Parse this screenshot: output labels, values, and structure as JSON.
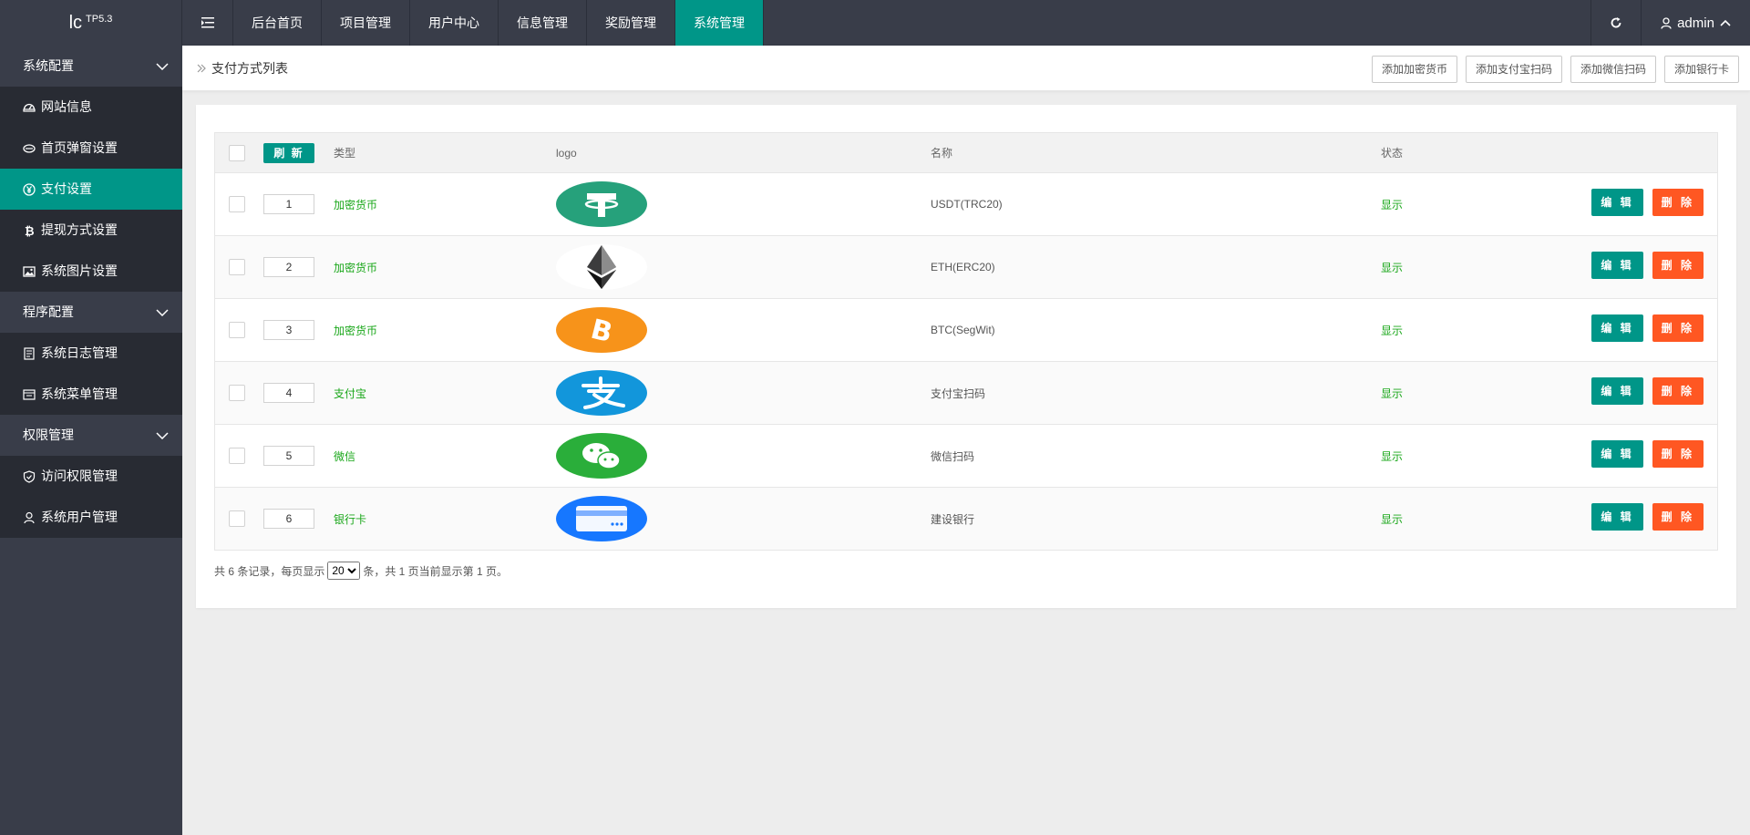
{
  "brand": {
    "name": "lc",
    "version": "TP5.3"
  },
  "topnav": [
    "后台首页",
    "项目管理",
    "用户中心",
    "信息管理",
    "奖励管理",
    "系统管理"
  ],
  "topnav_active": 5,
  "user": {
    "name": "admin"
  },
  "sidebar": {
    "groups": [
      {
        "label": "系统配置",
        "items": [
          {
            "label": "网站信息",
            "icon": "dashboard-icon"
          },
          {
            "label": "首页弹窗设置",
            "icon": "popup-icon"
          },
          {
            "label": "支付设置",
            "icon": "yen-icon",
            "active": true
          },
          {
            "label": "提现方式设置",
            "icon": "bitcoin-icon"
          },
          {
            "label": "系统图片设置",
            "icon": "image-icon"
          }
        ]
      },
      {
        "label": "程序配置",
        "items": [
          {
            "label": "系统日志管理",
            "icon": "log-icon"
          },
          {
            "label": "系统菜单管理",
            "icon": "menu-icon"
          }
        ]
      },
      {
        "label": "权限管理",
        "items": [
          {
            "label": "访问权限管理",
            "icon": "shield-icon"
          },
          {
            "label": "系统用户管理",
            "icon": "user-icon"
          }
        ]
      }
    ]
  },
  "page": {
    "breadcrumb": "支付方式列表",
    "buttons": [
      "添加加密货币",
      "添加支付宝扫码",
      "添加微信扫码",
      "添加银行卡"
    ]
  },
  "table": {
    "refresh_label": "刷 新",
    "headers": {
      "type": "类型",
      "logo": "logo",
      "name": "名称",
      "state": "状态"
    },
    "rows": [
      {
        "sort": "1",
        "type": "加密货币",
        "name": "USDT(TRC20)",
        "state": "显示",
        "logo": "tether-logo"
      },
      {
        "sort": "2",
        "type": "加密货币",
        "name": "ETH(ERC20)",
        "state": "显示",
        "logo": "ethereum-logo"
      },
      {
        "sort": "3",
        "type": "加密货币",
        "name": "BTC(SegWit)",
        "state": "显示",
        "logo": "bitcoin-logo"
      },
      {
        "sort": "4",
        "type": "支付宝",
        "name": "支付宝扫码",
        "state": "显示",
        "logo": "alipay-logo"
      },
      {
        "sort": "5",
        "type": "微信",
        "name": "微信扫码",
        "state": "显示",
        "logo": "wechat-logo"
      },
      {
        "sort": "6",
        "type": "银行卡",
        "name": "建设银行",
        "state": "显示",
        "logo": "bankcard-logo"
      }
    ],
    "edit_label": "编 辑",
    "delete_label": "删 除"
  },
  "pager": {
    "prefix": "共 6 条记录，每页显示",
    "page_size": "20",
    "suffix": "条，共 1 页当前显示第 1 页。"
  },
  "colors": {
    "primary": "#009688",
    "danger": "#ff5722",
    "sidebar": "#393d49",
    "green_text": "#1aa71a"
  }
}
